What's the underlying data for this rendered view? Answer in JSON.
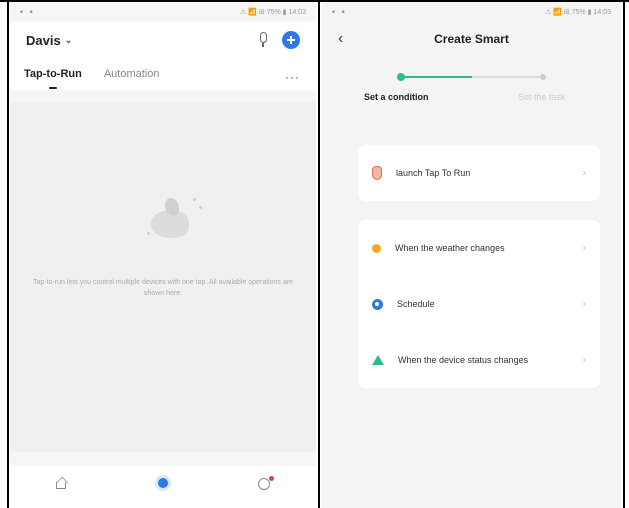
{
  "left_screen": {
    "status_bar": {
      "right_text": "⚠ 📶 ⊞ 75% ▮ 14:03"
    },
    "header": {
      "home_name": "Davis",
      "home_chevron": "⌄"
    },
    "tabs": [
      {
        "label": "Tap-to-Run",
        "active": true
      },
      {
        "label": "Automation",
        "active": false
      }
    ],
    "more_label": "···",
    "empty_state": {
      "message": "Tap-to-run lets you control multiple devices with one tap. All available operations are shown here."
    },
    "bottom_nav": [
      {
        "icon": "home-icon",
        "label": ""
      },
      {
        "icon": "smart-icon",
        "label": ""
      },
      {
        "icon": "me-icon",
        "label": ""
      }
    ]
  },
  "right_screen": {
    "status_bar": {
      "right_text": "⚠ 📶 ⊞ 75% ▮ 14:03"
    },
    "back_glyph": "‹",
    "title": "Create Smart",
    "stepper": {
      "step1_label": "Set a condition",
      "step2_label": "Set the task"
    },
    "card1": [
      {
        "icon": "hand-icon",
        "label": "launch Tap To Run",
        "chevron": "›"
      }
    ],
    "card2": [
      {
        "icon": "sun-icon",
        "label": "When the weather changes",
        "chevron": "›"
      },
      {
        "icon": "clock-icon",
        "label": "Schedule",
        "chevron": "›"
      },
      {
        "icon": "device-icon",
        "label": "When the device status changes",
        "chevron": "›"
      }
    ]
  },
  "colors": {
    "accent_blue": "#2f78e6",
    "step_green": "#2dbb8c",
    "notification_red": "#e8413c"
  }
}
